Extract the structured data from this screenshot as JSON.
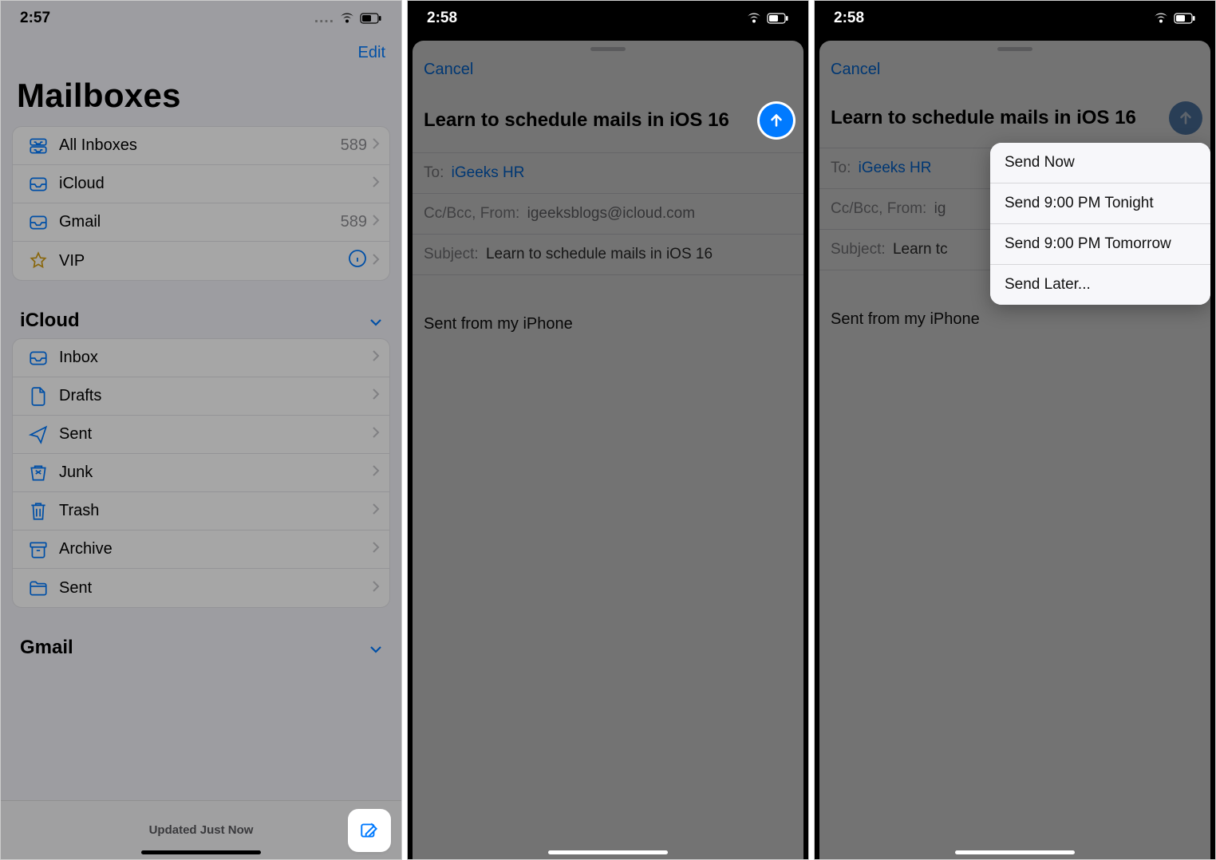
{
  "screen1": {
    "time": "2:57",
    "edit": "Edit",
    "title": "Mailboxes",
    "mailboxes": [
      {
        "label": "All Inboxes",
        "count": "589"
      },
      {
        "label": "iCloud",
        "count": ""
      },
      {
        "label": "Gmail",
        "count": "589"
      },
      {
        "label": "VIP",
        "count": ""
      }
    ],
    "section_icloud": "iCloud",
    "icloud_folders": [
      {
        "label": "Inbox"
      },
      {
        "label": "Drafts"
      },
      {
        "label": "Sent"
      },
      {
        "label": "Junk"
      },
      {
        "label": "Trash"
      },
      {
        "label": "Archive"
      },
      {
        "label": "Sent"
      }
    ],
    "section_gmail": "Gmail",
    "status": "Updated Just Now"
  },
  "screen2": {
    "time": "2:58",
    "cancel": "Cancel",
    "title": "Learn to schedule mails in iOS 16",
    "to_label": "To:",
    "to_value": "iGeeks HR",
    "ccfrom_label": "Cc/Bcc, From:",
    "ccfrom_value": "igeeksblogs@icloud.com",
    "subject_label": "Subject:",
    "subject_value": "Learn to schedule mails in iOS 16",
    "body": "Sent from my iPhone"
  },
  "screen3": {
    "time": "2:58",
    "cancel": "Cancel",
    "title": "Learn to schedule mails in iOS 16",
    "to_label": "To:",
    "to_value": "iGeeks HR",
    "ccfrom_label": "Cc/Bcc, From:",
    "ccfrom_value": "ig",
    "subject_label": "Subject:",
    "subject_value": "Learn tc",
    "body": "Sent from my iPhone",
    "popover": [
      "Send Now",
      "Send 9:00 PM Tonight",
      "Send 9:00 PM Tomorrow",
      "Send Later..."
    ]
  }
}
